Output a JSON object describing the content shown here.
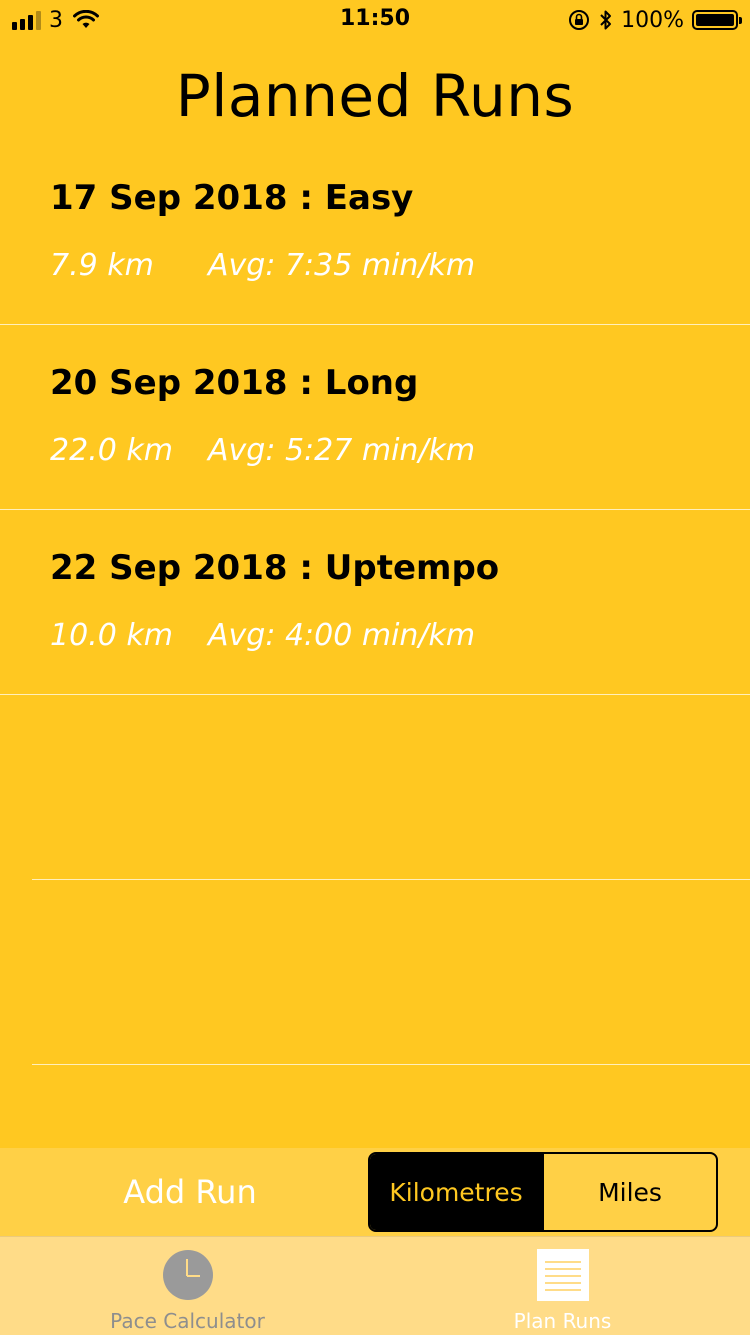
{
  "status_bar": {
    "carrier": "3",
    "time": "11:50",
    "battery": "100%"
  },
  "page_title": "Planned Runs",
  "runs": [
    {
      "title": "17 Sep 2018 : Easy",
      "distance": "7.9 km",
      "avg": "Avg: 7:35 min/km"
    },
    {
      "title": "20 Sep 2018 : Long",
      "distance": "22.0 km",
      "avg": "Avg: 5:27 min/km"
    },
    {
      "title": "22 Sep 2018 : Uptempo",
      "distance": "10.0 km",
      "avg": "Avg: 4:00 min/km"
    }
  ],
  "controls": {
    "add_run": "Add Run",
    "units": {
      "selected": "Kilometres",
      "options": [
        "Kilometres",
        "Miles"
      ]
    }
  },
  "tabs": [
    {
      "label": "Pace Calculator",
      "icon": "clock-icon",
      "active": false
    },
    {
      "label": "Plan Runs",
      "icon": "list-icon",
      "active": true
    }
  ],
  "colors": {
    "background": "#FFC821",
    "tabbar": "#FFDC88",
    "accent_text": "#FFFFFF"
  }
}
